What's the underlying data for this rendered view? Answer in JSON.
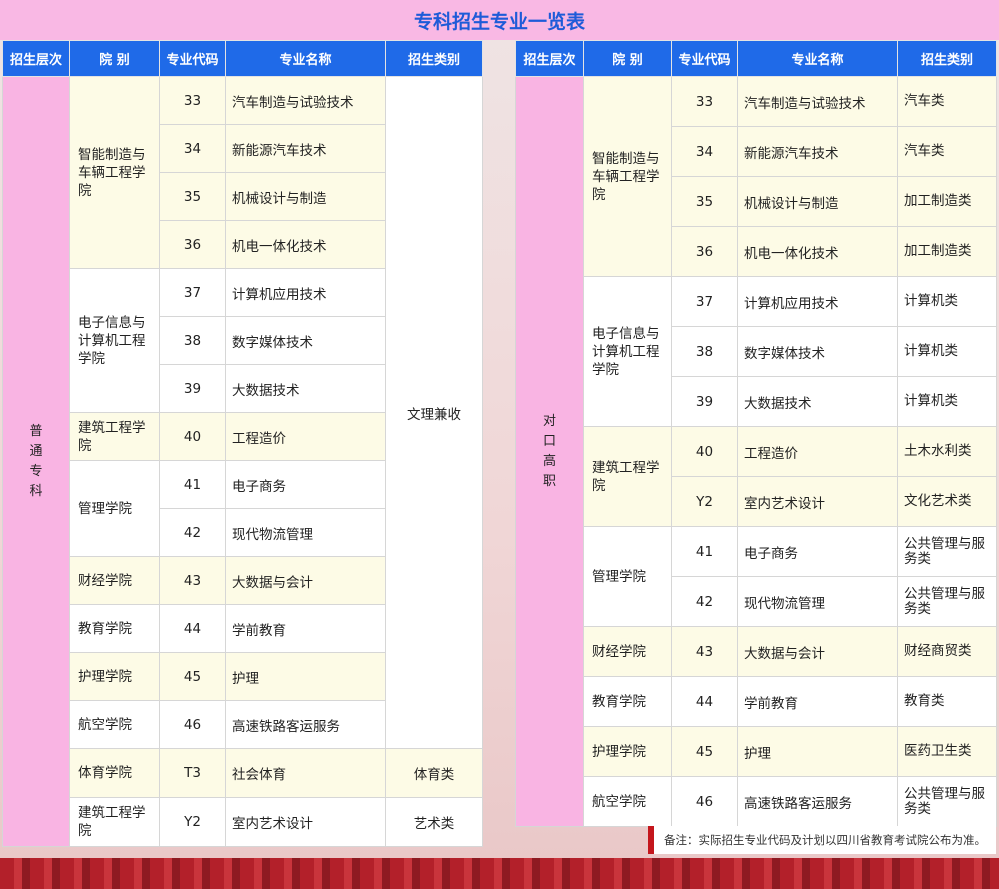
{
  "title": "专科招生专业一览表",
  "headers": [
    "招生层次",
    "院 别",
    "专业代码",
    "专业名称",
    "招生类别"
  ],
  "left": {
    "level": "普通专科",
    "groups": [
      {
        "college": "智能制造与车辆工程学院",
        "majors": [
          {
            "code": "33",
            "name": "汽车制造与试验技术"
          },
          {
            "code": "34",
            "name": "新能源汽车技术"
          },
          {
            "code": "35",
            "name": "机械设计与制造"
          },
          {
            "code": "36",
            "name": "机电一体化技术"
          }
        ]
      },
      {
        "college": "电子信息与计算机工程学院",
        "majors": [
          {
            "code": "37",
            "name": "计算机应用技术"
          },
          {
            "code": "38",
            "name": "数字媒体技术"
          },
          {
            "code": "39",
            "name": "大数据技术"
          }
        ]
      },
      {
        "college": "建筑工程学院",
        "majors": [
          {
            "code": "40",
            "name": "工程造价"
          }
        ]
      },
      {
        "college": "管理学院",
        "majors": [
          {
            "code": "41",
            "name": "电子商务"
          },
          {
            "code": "42",
            "name": "现代物流管理"
          }
        ]
      },
      {
        "college": "财经学院",
        "majors": [
          {
            "code": "43",
            "name": "大数据与会计"
          }
        ]
      },
      {
        "college": "教育学院",
        "majors": [
          {
            "code": "44",
            "name": "学前教育"
          }
        ]
      },
      {
        "college": "护理学院",
        "majors": [
          {
            "code": "45",
            "name": "护理"
          }
        ]
      },
      {
        "college": "航空学院",
        "majors": [
          {
            "code": "46",
            "name": "高速铁路客运服务"
          }
        ]
      },
      {
        "college": "体育学院",
        "majors": [
          {
            "code": "T3",
            "name": "社会体育"
          }
        ]
      },
      {
        "college": "建筑工程学院",
        "majors": [
          {
            "code": "Y2",
            "name": "室内艺术设计"
          }
        ]
      }
    ],
    "categories": {
      "main": "文理兼收",
      "sports": "体育类",
      "art": "艺术类"
    }
  },
  "right": {
    "level": "对口高职",
    "groups": [
      {
        "college": "智能制造与车辆工程学院",
        "majors": [
          {
            "code": "33",
            "name": "汽车制造与试验技术",
            "category": "汽车类"
          },
          {
            "code": "34",
            "name": "新能源汽车技术",
            "category": "汽车类"
          },
          {
            "code": "35",
            "name": "机械设计与制造",
            "category": "加工制造类"
          },
          {
            "code": "36",
            "name": "机电一体化技术",
            "category": "加工制造类"
          }
        ]
      },
      {
        "college": "电子信息与计算机工程学院",
        "majors": [
          {
            "code": "37",
            "name": "计算机应用技术",
            "category": "计算机类"
          },
          {
            "code": "38",
            "name": "数字媒体技术",
            "category": "计算机类"
          },
          {
            "code": "39",
            "name": "大数据技术",
            "category": "计算机类"
          }
        ]
      },
      {
        "college": "建筑工程学院",
        "majors": [
          {
            "code": "40",
            "name": "工程造价",
            "category": "土木水利类"
          },
          {
            "code": "Y2",
            "name": "室内艺术设计",
            "category": "文化艺术类"
          }
        ]
      },
      {
        "college": "管理学院",
        "majors": [
          {
            "code": "41",
            "name": "电子商务",
            "category": "公共管理与服务类"
          },
          {
            "code": "42",
            "name": "现代物流管理",
            "category": "公共管理与服务类"
          }
        ]
      },
      {
        "college": "财经学院",
        "majors": [
          {
            "code": "43",
            "name": "大数据与会计",
            "category": "财经商贸类"
          }
        ]
      },
      {
        "college": "教育学院",
        "majors": [
          {
            "code": "44",
            "name": "学前教育",
            "category": "教育类"
          }
        ]
      },
      {
        "college": "护理学院",
        "majors": [
          {
            "code": "45",
            "name": "护理",
            "category": "医药卫生类"
          }
        ]
      },
      {
        "college": "航空学院",
        "majors": [
          {
            "code": "46",
            "name": "高速铁路客运服务",
            "category": "公共管理与服务类"
          }
        ]
      }
    ]
  },
  "note": "备注：实际招生专业代码及计划以四川省教育考试院公布为准。",
  "colors": {
    "header": "#1f6ae8",
    "title_bg": "#f9b8e4",
    "title_text": "#1e5bd8",
    "level_bg": "#f9b4e3",
    "row_highlight": "#fdfbe6",
    "note_bar": "#c4161c"
  }
}
